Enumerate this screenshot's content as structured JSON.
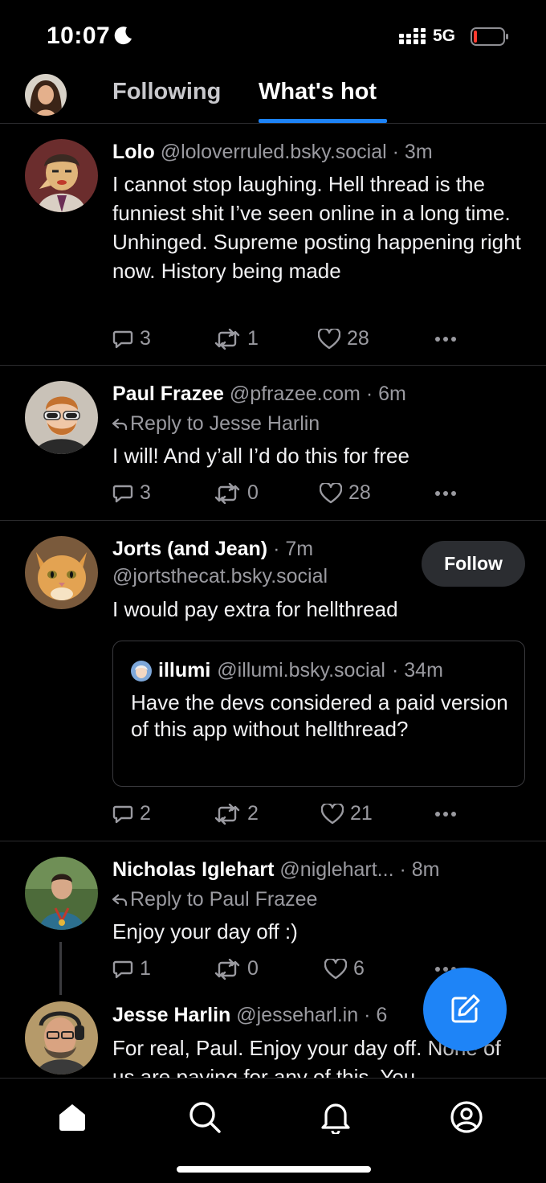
{
  "status_bar": {
    "time": "10:07",
    "network": "5G"
  },
  "tabs": [
    {
      "label": "Following",
      "active": false
    },
    {
      "label": "What's hot",
      "active": true
    }
  ],
  "accent_color": "#1d83f7",
  "posts": [
    {
      "name": "Lolo",
      "handle": "@loloverruled.bsky.social",
      "time": "· 3m",
      "text": "I cannot stop laughing. Hell thread is the funniest shit I’ve seen online in a long time. Unhinged. Supreme posting happening right now. History being made",
      "replies": "3",
      "reposts": "1",
      "likes": "28"
    },
    {
      "name": "Paul Frazee",
      "handle": "@pfrazee.com",
      "time": "· 6m",
      "reply_to": "Reply to Jesse Harlin",
      "text": "I will! And y’all I’d do this for free",
      "replies": "3",
      "reposts": "0",
      "likes": "28"
    },
    {
      "name": "Jorts (and Jean)",
      "handle": "@jortsthecat.bsky.social",
      "time": "· 7m",
      "follow_label": "Follow",
      "text": "I would pay extra for hellthread",
      "quote": {
        "name": "illumi",
        "handle": "@illumi.bsky.social",
        "time": "· 34m",
        "text": "Have the devs considered a paid version of this app without hellthread?"
      },
      "replies": "2",
      "reposts": "2",
      "likes": "21"
    },
    {
      "name": "Nicholas Iglehart",
      "handle": "@niglehart...",
      "time": "· 8m",
      "reply_to": "Reply to Paul Frazee",
      "text": "Enjoy your day off :)",
      "replies": "1",
      "reposts": "0",
      "likes": "6"
    },
    {
      "name": "Jesse Harlin",
      "handle": "@jesseharl.in",
      "time": "· 6",
      "text": "For real, Paul. Enjoy your day off. None of us are paying for any of this. You"
    }
  ],
  "icons": {
    "reply": "speech-bubble-icon",
    "repost": "repost-icon",
    "like": "heart-icon",
    "more": "ellipsis-icon",
    "compose": "compose-icon",
    "home": "home-icon",
    "search": "search-icon",
    "notifications": "bell-icon",
    "profile": "profile-icon"
  }
}
